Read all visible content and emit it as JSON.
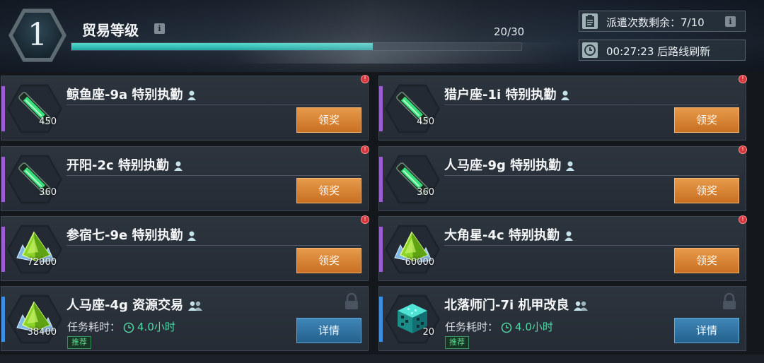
{
  "header": {
    "level": "1",
    "title": "贸易等级",
    "info_icon": "i",
    "xp_text": "20/30",
    "xp_progress": 0.67,
    "dispatch_text": "派遣次数剩余：7/10",
    "refresh_text": "00:27:23 后路线刷新"
  },
  "colors": {
    "accent_purple": "#9a5dd4",
    "accent_blue": "#3d8ee0",
    "claim_button": "#d8843a",
    "detail_button": "#2f75a6",
    "time_green": "#52d6a4"
  },
  "missions": [
    {
      "name": "鲸鱼座-9a 特别执勤",
      "qty": "450",
      "button": "领奖",
      "item_icon": "green-rod-icon"
    },
    {
      "name": "猎户座-1i 特别执勤",
      "qty": "450",
      "button": "领奖",
      "item_icon": "green-rod-icon"
    },
    {
      "name": "开阳-2c 特别执勤",
      "qty": "360",
      "button": "领奖",
      "item_icon": "green-rod-icon"
    },
    {
      "name": "人马座-9g 特别执勤",
      "qty": "360",
      "button": "领奖",
      "item_icon": "green-rod-icon"
    },
    {
      "name": "参宿七-9e 特别执勤",
      "qty": "72000",
      "button": "领奖",
      "item_icon": "crystal-icon"
    },
    {
      "name": "大角星-4c 特别执勤",
      "qty": "60000",
      "button": "领奖",
      "item_icon": "crystal-icon"
    },
    {
      "name": "人马座-4g 资源交易",
      "qty": "38400",
      "button": "详情",
      "item_icon": "crystal-icon",
      "time_label": "任务耗时：",
      "time_value": "4.0小时",
      "tag": "推荐"
    },
    {
      "name": "北落师门-7i 机甲改良",
      "qty": "20",
      "button": "详情",
      "item_icon": "tech-cube-icon",
      "time_label": "任务耗时：",
      "time_value": "4.0小时",
      "tag": "推荐"
    }
  ]
}
